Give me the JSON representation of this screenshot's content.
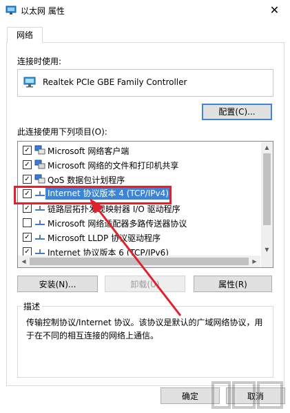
{
  "window": {
    "title": "以太网 属性",
    "close_glyph": "✕"
  },
  "tabs": [
    {
      "label": "网络"
    }
  ],
  "connect_using": {
    "label": "连接时使用:",
    "adapter": "Realtek PCIe GBE Family Controller"
  },
  "buttons": {
    "configure": "配置(C)...",
    "install": "安装(N)...",
    "uninstall": "卸载(U)",
    "properties": "属性(R)",
    "ok": "确定",
    "cancel": "取消"
  },
  "items_label": "此连接使用下列项目(O):",
  "items": [
    {
      "label": "Microsoft 网络客户端",
      "checked": true
    },
    {
      "label": "Microsoft 网络的文件和打印机共享",
      "checked": true
    },
    {
      "label": "QoS 数据包计划程序",
      "checked": true
    },
    {
      "label": "Internet 协议版本 4 (TCP/IPv4)",
      "checked": true,
      "selected": true
    },
    {
      "label": "链路层拓扑发现映射器 I/O 驱动程序",
      "checked": true
    },
    {
      "label": "Microsoft 网络适配器多路传送器协议",
      "checked": false
    },
    {
      "label": "Microsoft LLDP 协议驱动程序",
      "checked": true
    },
    {
      "label": "Internet 协议版本 6 (TCP/IPv6)",
      "checked": true
    }
  ],
  "description": {
    "title": "描述",
    "text": "传输控制协议/Internet 协议。该协议是默认的广域网络协议，用于在不同的相互连接的网络上通信。"
  },
  "colors": {
    "accent": "#3c84d6",
    "annotation": "#e0212b"
  }
}
